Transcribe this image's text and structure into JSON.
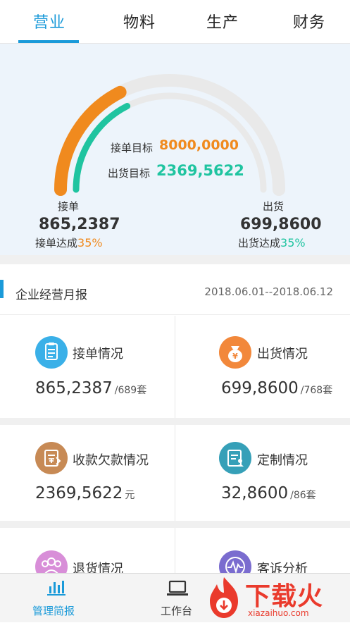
{
  "tabs": [
    "营业",
    "物料",
    "生产",
    "财务"
  ],
  "gauge": {
    "order_target_label": "接单目标",
    "order_target_value": "8000,0000",
    "ship_target_label": "出货目标",
    "ship_target_value": "2369,5622",
    "order_label": "接单",
    "order_value": "865,2387",
    "order_rate_label": "接单达成",
    "order_rate_value": "35%",
    "ship_label": "出货",
    "ship_value": "699,8600",
    "ship_rate_label": "出货达成",
    "ship_rate_value": "35%",
    "order_progress": 0.35,
    "ship_progress": 0.35,
    "colors": {
      "orange": "#f08a1e",
      "teal": "#1fc4a0",
      "track": "#e9e9e9"
    }
  },
  "report": {
    "title": "企业经营月报",
    "range": "2018.06.01--2018.06.12"
  },
  "cards": [
    {
      "label": "接单情况",
      "value": "865,2387",
      "unit": "/689套",
      "icon": "clipboard-icon",
      "color": "#3ab0e8"
    },
    {
      "label": "出货情况",
      "value": "699,8600",
      "unit": "/768套",
      "icon": "money-bag-icon",
      "color": "#f2883b"
    },
    {
      "label": "收款欠款情况",
      "value": "2369,5622",
      "unit": "元",
      "icon": "receipt-icon",
      "color": "#c78a55"
    },
    {
      "label": "定制情况",
      "value": "32,8600",
      "unit": "/86套",
      "icon": "custom-doc-icon",
      "color": "#36a0b8"
    },
    {
      "label": "退货情况",
      "value": "",
      "unit": "",
      "icon": "users-icon",
      "color": "#d88ed8"
    },
    {
      "label": "客诉分析",
      "value": "",
      "unit": "",
      "icon": "pulse-icon",
      "color": "#7a6ccf"
    }
  ],
  "bottom_nav": [
    {
      "label": "管理简报",
      "icon": "bar-chart-icon",
      "active": true
    },
    {
      "label": "工作台",
      "icon": "laptop-icon",
      "active": false
    }
  ],
  "watermark": {
    "text": "下载火",
    "url": "xiazaihuo.com"
  },
  "accent_color": "#1a9ad9"
}
